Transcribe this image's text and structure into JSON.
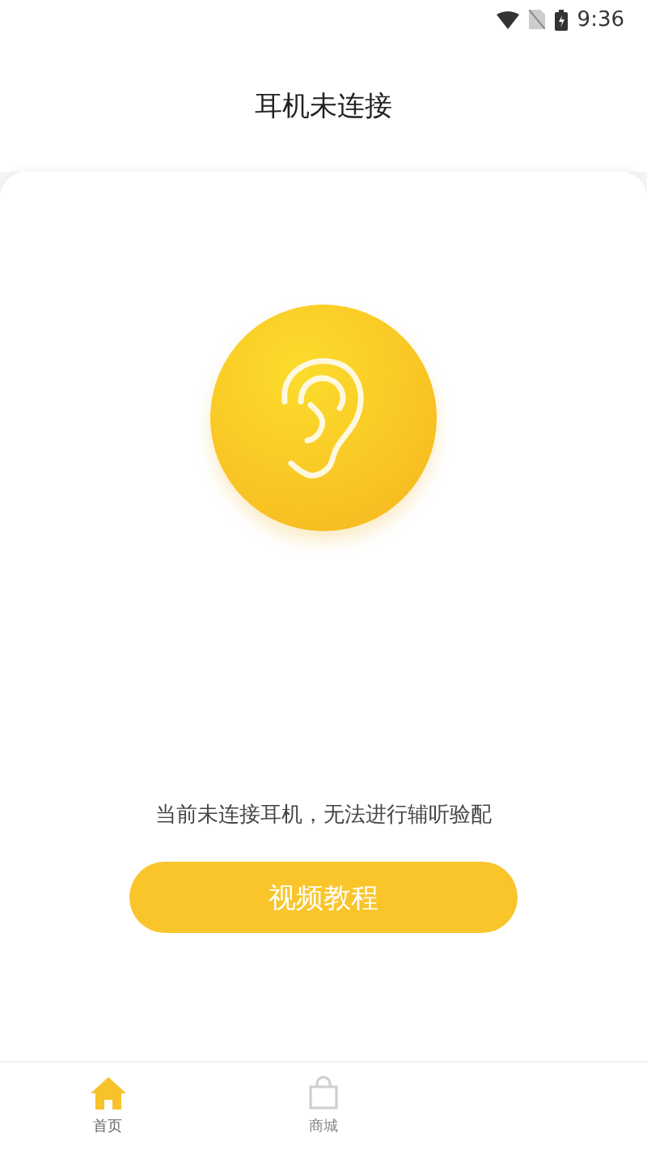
{
  "status_bar": {
    "time": "9:36"
  },
  "header": {
    "title": "耳机未连接"
  },
  "message": "当前未连接耳机，无法进行辅听验配",
  "action_button": "视频教程",
  "bottom_nav": [
    {
      "label": "首页",
      "kind": "home",
      "selected": true
    },
    {
      "label": "商城",
      "kind": "shop",
      "selected": false
    }
  ]
}
